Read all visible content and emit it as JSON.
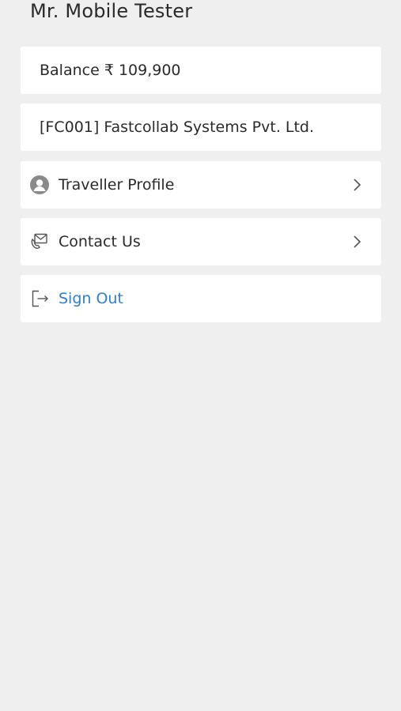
{
  "profile": {
    "name": "Mr. Mobile Tester"
  },
  "balance": {
    "text": "Balance ₹ 109,900"
  },
  "company": {
    "text": "[FC001] Fastcollab Systems Pvt. Ltd."
  },
  "menu": {
    "items": [
      {
        "label": "Traveller Profile",
        "icon": "user-avatar-icon"
      },
      {
        "label": "Contact Us",
        "icon": "contact-envelope-icon"
      },
      {
        "label": "Sign Out",
        "icon": "sign-out-icon"
      }
    ]
  },
  "colors": {
    "background": "#efefef",
    "card": "#ffffff",
    "sign_out": "#2b7fd6"
  }
}
